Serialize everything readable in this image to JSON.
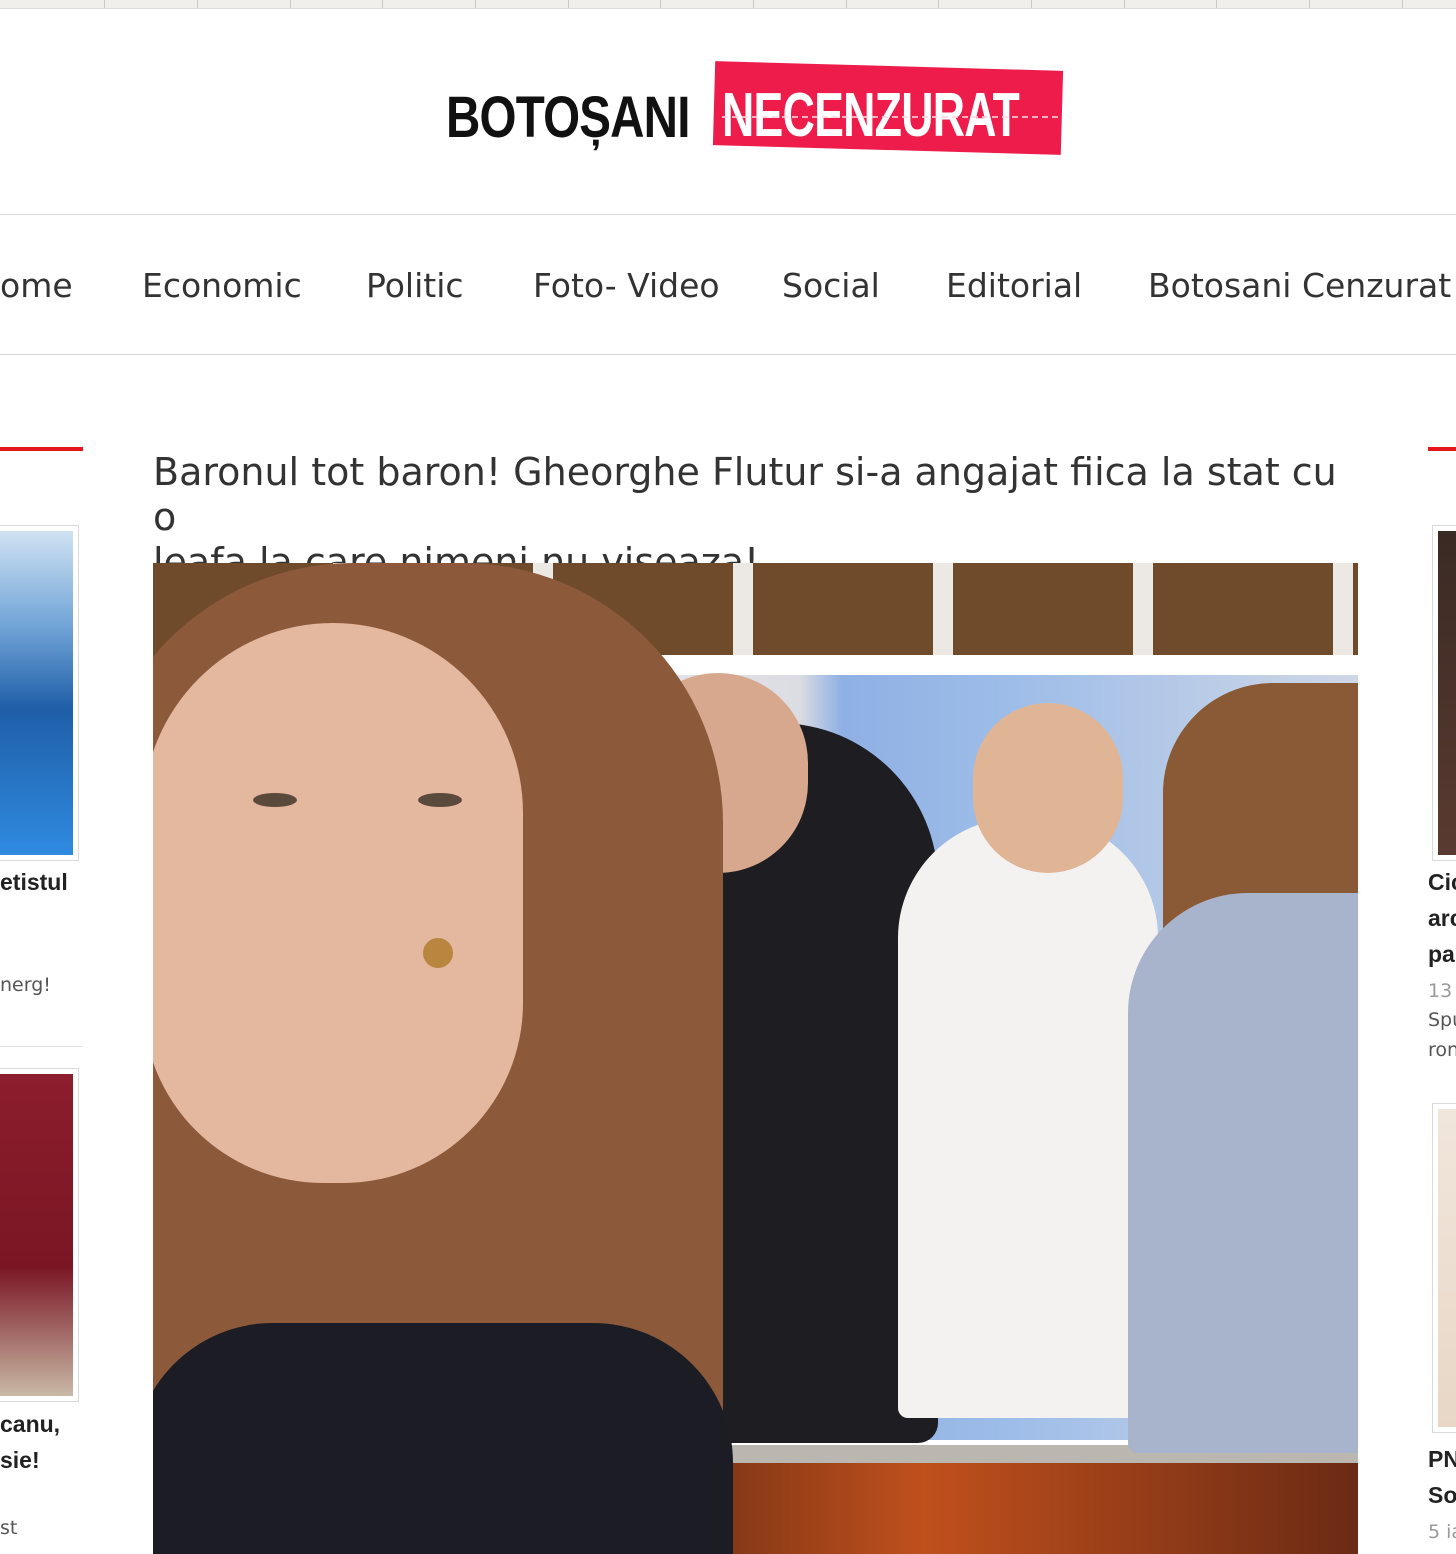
{
  "logo": {
    "part1": "BOTOȘANI",
    "part2": "NECENZURAT"
  },
  "nav": {
    "items": [
      "ome",
      "Economic",
      "Politic",
      "Foto- Video",
      "Social",
      "Editorial",
      "Botosani Cenzurat"
    ]
  },
  "article": {
    "title_line1": "Baronul tot baron! Gheorghe Flutur si-a angajat fiica la stat cu o",
    "title_line2": "leafa la care nimeni nu viseaza!"
  },
  "left_sidebar": {
    "post1": {
      "headline": "etistul",
      "excerpt": "nerg!"
    },
    "post2": {
      "headline_line1": "canu,",
      "headline_line2": "sie!",
      "excerpt": "st"
    }
  },
  "right_sidebar": {
    "post1": {
      "headline_line1": "Cic",
      "headline_line2": "arc",
      "headline_line3": "pa",
      "date": "13 r",
      "excerpt_line1": "Spu",
      "excerpt_line2": "ron"
    },
    "post2": {
      "headline_line1": "PN",
      "headline_line2": "So",
      "date": "5 ia"
    }
  },
  "colors": {
    "accent_red": "#e3161c",
    "logo_red": "#ee1c4b"
  }
}
